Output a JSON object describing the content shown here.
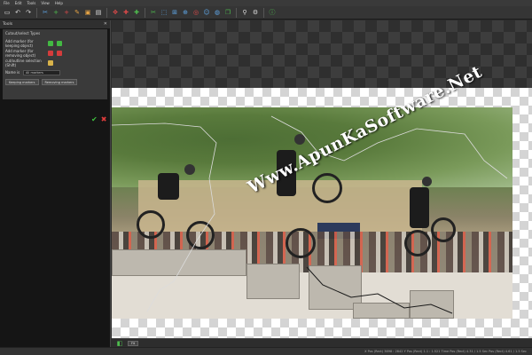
{
  "menu": [
    "File",
    "Edit",
    "Tools",
    "View",
    "Help"
  ],
  "toolbar": {
    "icons": [
      {
        "name": "open-icon",
        "glyph": "▭",
        "tone": ""
      },
      {
        "name": "undo-icon",
        "glyph": "↶",
        "tone": ""
      },
      {
        "name": "redo-icon",
        "glyph": "↷",
        "tone": ""
      },
      {
        "name": "sep",
        "glyph": "",
        "tone": "sep"
      },
      {
        "name": "cut-icon",
        "glyph": "✂",
        "tone": "blue"
      },
      {
        "name": "add-keep-icon",
        "glyph": "+",
        "tone": "green"
      },
      {
        "name": "add-remove-icon",
        "glyph": "+",
        "tone": "red"
      },
      {
        "name": "brush-icon",
        "glyph": "✎",
        "tone": "orange"
      },
      {
        "name": "select-icon",
        "glyph": "▣",
        "tone": "orange"
      },
      {
        "name": "doc-icon",
        "glyph": "▤",
        "tone": ""
      },
      {
        "name": "sep",
        "glyph": "",
        "tone": "sep"
      },
      {
        "name": "move-icon",
        "glyph": "✥",
        "tone": "red"
      },
      {
        "name": "marker-icon",
        "glyph": "✚",
        "tone": "red"
      },
      {
        "name": "keep-marker-icon",
        "glyph": "✚",
        "tone": "green"
      },
      {
        "name": "sep",
        "glyph": "",
        "tone": "sep"
      },
      {
        "name": "scissors-icon",
        "glyph": "✂",
        "tone": "green"
      },
      {
        "name": "transform-icon",
        "glyph": "⬚",
        "tone": "blue"
      },
      {
        "name": "grid-icon",
        "glyph": "⊞",
        "tone": "blue"
      },
      {
        "name": "crosshair-icon",
        "glyph": "⊕",
        "tone": "blue"
      },
      {
        "name": "target-icon",
        "glyph": "◎",
        "tone": "red"
      },
      {
        "name": "person-icon",
        "glyph": "☺",
        "tone": "blue"
      },
      {
        "name": "globe-icon",
        "glyph": "◍",
        "tone": "blue"
      },
      {
        "name": "copy-icon",
        "glyph": "❐",
        "tone": "green"
      },
      {
        "name": "sep",
        "glyph": "",
        "tone": "sep"
      },
      {
        "name": "zoom-icon",
        "glyph": "⚲",
        "tone": ""
      },
      {
        "name": "settings-icon",
        "glyph": "⚙",
        "tone": ""
      },
      {
        "name": "sep",
        "glyph": "",
        "tone": "sep"
      },
      {
        "name": "info-icon",
        "glyph": "ⓘ",
        "tone": "green"
      }
    ]
  },
  "panel": {
    "title": "Tools",
    "heading": "Cutout/select Types",
    "rows": [
      {
        "label": "Add marker (for keeping object)",
        "color": "g"
      },
      {
        "label": "Add marker (for removing object)",
        "color": "r"
      },
      {
        "label": "cut/outline selection (Shift)",
        "color": "y"
      }
    ],
    "field_label": "Name is",
    "field_value": "All markers",
    "buttons": [
      "Keeping markers",
      "Removing markers"
    ]
  },
  "canvas": {
    "watermark": "Www.ApunKaSoftware.Net"
  },
  "bottom": {
    "zoom_value": "Fit"
  },
  "status": {
    "text": "X Pos (Rect) 3898 : 2842    Y Pos (Rect) 1.1 : 1.521    Time Pos (Rect) 4.31 / 1.5 Sec    Pos (Rect) 4.61 / 1.5 Sec"
  }
}
